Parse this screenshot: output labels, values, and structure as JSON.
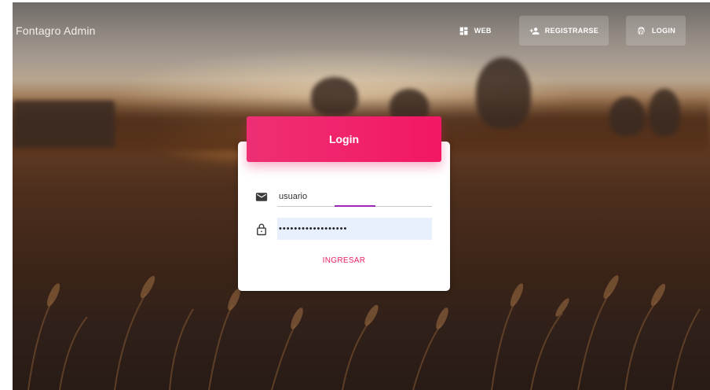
{
  "header": {
    "title": "Fontagro Admin",
    "nav": [
      {
        "label": "WEB",
        "icon": "dashboard-icon"
      },
      {
        "label": "REGISTRARSE",
        "icon": "person-add-icon"
      },
      {
        "label": "LOGIN",
        "icon": "fingerprint-icon"
      }
    ]
  },
  "login": {
    "title": "Login",
    "username_value": "usuario",
    "password_value": "••••••••••••••••••",
    "submit_label": "INGRESAR"
  },
  "colors": {
    "accent": "#e91e63",
    "focus": "#9c27b0",
    "autofill": "#e8f0fe"
  }
}
